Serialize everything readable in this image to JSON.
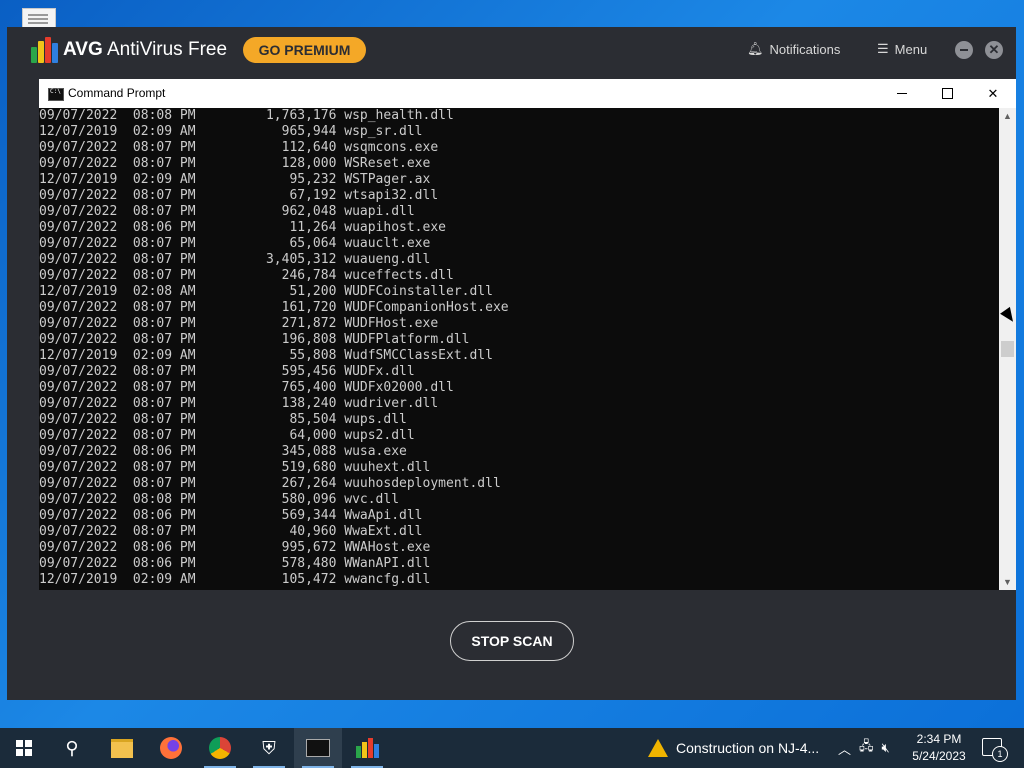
{
  "avg": {
    "title_brand": "AVG",
    "title_rest": "AntiVirus Free",
    "premium_label": "GO PREMIUM",
    "notifications_label": "Notifications",
    "menu_label": "Menu",
    "stop_scan_label": "STOP SCAN",
    "accent_color": "#f4a827"
  },
  "cmd": {
    "title": "Command Prompt",
    "lines": [
      "09/07/2022  08:08 PM         1,763,176 wsp_health.dll",
      "12/07/2019  02:09 AM           965,944 wsp_sr.dll",
      "09/07/2022  08:07 PM           112,640 wsqmcons.exe",
      "09/07/2022  08:07 PM           128,000 WSReset.exe",
      "12/07/2019  02:09 AM            95,232 WSTPager.ax",
      "09/07/2022  08:07 PM            67,192 wtsapi32.dll",
      "09/07/2022  08:07 PM           962,048 wuapi.dll",
      "09/07/2022  08:06 PM            11,264 wuapihost.exe",
      "09/07/2022  08:07 PM            65,064 wuauclt.exe",
      "09/07/2022  08:07 PM         3,405,312 wuaueng.dll",
      "09/07/2022  08:07 PM           246,784 wuceffects.dll",
      "12/07/2019  02:08 AM            51,200 WUDFCoinstaller.dll",
      "09/07/2022  08:07 PM           161,720 WUDFCompanionHost.exe",
      "09/07/2022  08:07 PM           271,872 WUDFHost.exe",
      "09/07/2022  08:07 PM           196,808 WUDFPlatform.dll",
      "12/07/2019  02:09 AM            55,808 WudfSMCClassExt.dll",
      "09/07/2022  08:07 PM           595,456 WUDFx.dll",
      "09/07/2022  08:07 PM           765,400 WUDFx02000.dll",
      "09/07/2022  08:07 PM           138,240 wudriver.dll",
      "09/07/2022  08:07 PM            85,504 wups.dll",
      "09/07/2022  08:07 PM            64,000 wups2.dll",
      "09/07/2022  08:06 PM           345,088 wusa.exe",
      "09/07/2022  08:07 PM           519,680 wuuhext.dll",
      "09/07/2022  08:07 PM           267,264 wuuhosdeployment.dll",
      "09/07/2022  08:08 PM           580,096 wvc.dll",
      "09/07/2022  08:06 PM           569,344 WwaApi.dll",
      "09/07/2022  08:07 PM            40,960 WwaExt.dll",
      "09/07/2022  08:06 PM           995,672 WWAHost.exe",
      "09/07/2022  08:06 PM           578,480 WWanAPI.dll",
      "12/07/2019  02:09 AM           105,472 wwancfg.dll"
    ]
  },
  "taskbar": {
    "weather_text": "Construction on NJ-4...",
    "time": "2:34 PM",
    "date": "5/24/2023",
    "notification_count": "1"
  }
}
